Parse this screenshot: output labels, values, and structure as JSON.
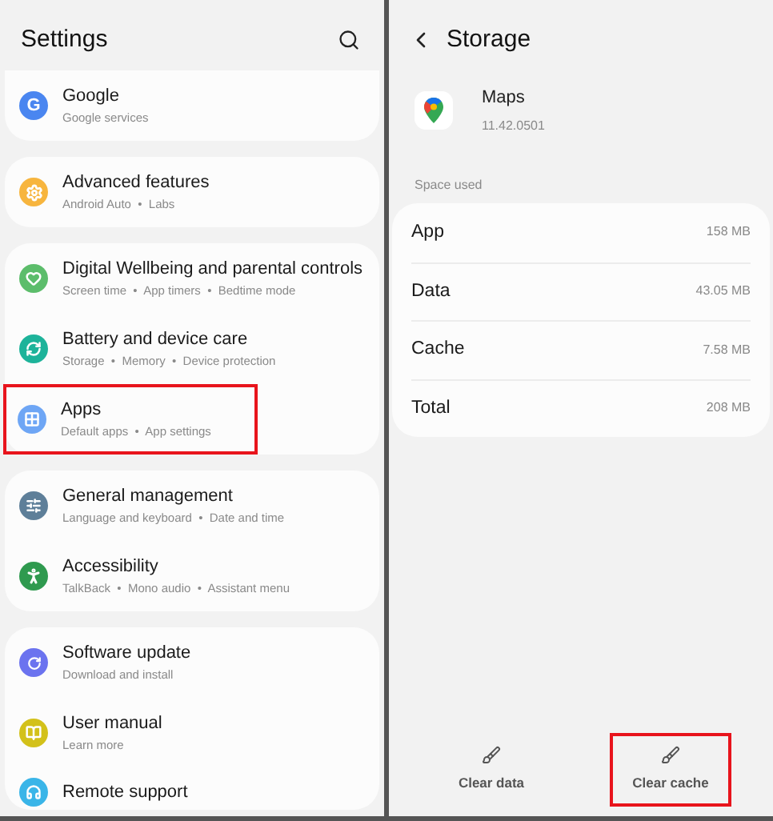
{
  "settings": {
    "title": "Settings",
    "groups": [
      {
        "items": [
          {
            "title": "Google",
            "subtitle": "Google services",
            "glyph": "G",
            "color": "#4a86f0",
            "highlighted": false
          }
        ]
      },
      {
        "items": [
          {
            "title": "Advanced features",
            "subtitle": "Android Auto  •  Labs",
            "color": "#f7b53e",
            "highlighted": false
          }
        ]
      },
      {
        "items": [
          {
            "title": "Digital Wellbeing and parental controls",
            "subtitle": "Screen time  •  App timers  •  Bedtime mode",
            "color": "#5cbd6b",
            "highlighted": false
          },
          {
            "title": "Battery and device care",
            "subtitle": "Storage  •  Memory  •  Device protection",
            "color": "#1db39a",
            "highlighted": false
          },
          {
            "title": "Apps",
            "subtitle": "Default apps  •  App settings",
            "color": "#6ea6f5",
            "highlighted": true
          }
        ]
      },
      {
        "items": [
          {
            "title": "General management",
            "subtitle": "Language and keyboard  •  Date and time",
            "color": "#5e7f99",
            "highlighted": false
          },
          {
            "title": "Accessibility",
            "subtitle": "TalkBack  •  Mono audio  •  Assistant menu",
            "color": "#2f9a4f",
            "highlighted": false
          }
        ]
      },
      {
        "items": [
          {
            "title": "Software update",
            "subtitle": "Download and install",
            "color": "#6b73ef",
            "highlighted": false
          },
          {
            "title": "User manual",
            "subtitle": "Learn more",
            "color": "#d3c11a",
            "highlighted": false
          },
          {
            "title": "Remote support",
            "color": "#3ab5e8",
            "highlighted": false
          }
        ]
      }
    ]
  },
  "storage": {
    "title": "Storage",
    "app": {
      "name": "Maps",
      "version": "11.42.0501"
    },
    "section": "Space used",
    "rows": [
      {
        "label": "App",
        "value": "158 MB"
      },
      {
        "label": "Data",
        "value": "43.05 MB"
      },
      {
        "label": "Cache",
        "value": "7.58 MB"
      },
      {
        "label": "Total",
        "value": "208 MB"
      }
    ],
    "actions": [
      {
        "label": "Clear data",
        "highlighted": false
      },
      {
        "label": "Clear cache",
        "highlighted": true
      }
    ]
  }
}
